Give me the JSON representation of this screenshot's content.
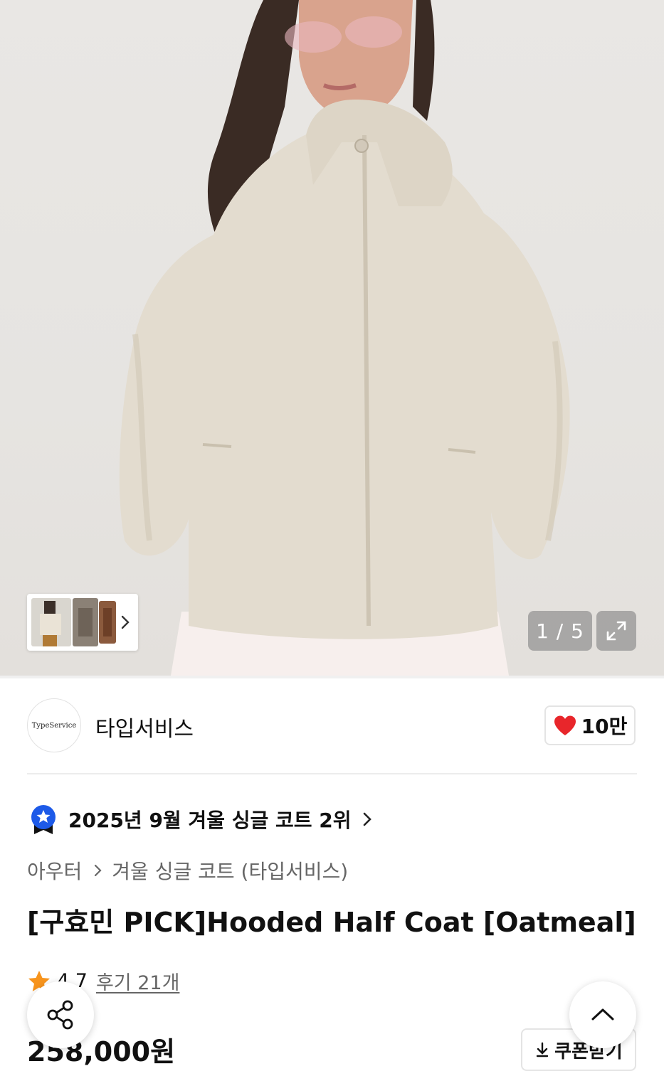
{
  "gallery": {
    "counter": "1 / 5",
    "icons": {
      "expand": "expand-icon",
      "thumb_next": "chevron-right-icon"
    }
  },
  "brand": {
    "logo_text": "TypeService",
    "name": "타입서비스",
    "like_count": "10만",
    "like_color": "#e8262b"
  },
  "ranking": {
    "text": "2025년 9월 겨울 싱글 코트 2위",
    "badge_color": "#1d5ae8"
  },
  "breadcrumb": {
    "items": [
      "아우터",
      "겨울 싱글 코트 (타입서비스)"
    ]
  },
  "product": {
    "title": "[구효민 PICK]Hooded Half Coat [Oatmeal]",
    "rating": "4.7",
    "reviews": "후기 21개",
    "price": "258,000원",
    "star_color": "#f7941d"
  },
  "actions": {
    "coupon_label": "쿠폰받기"
  }
}
